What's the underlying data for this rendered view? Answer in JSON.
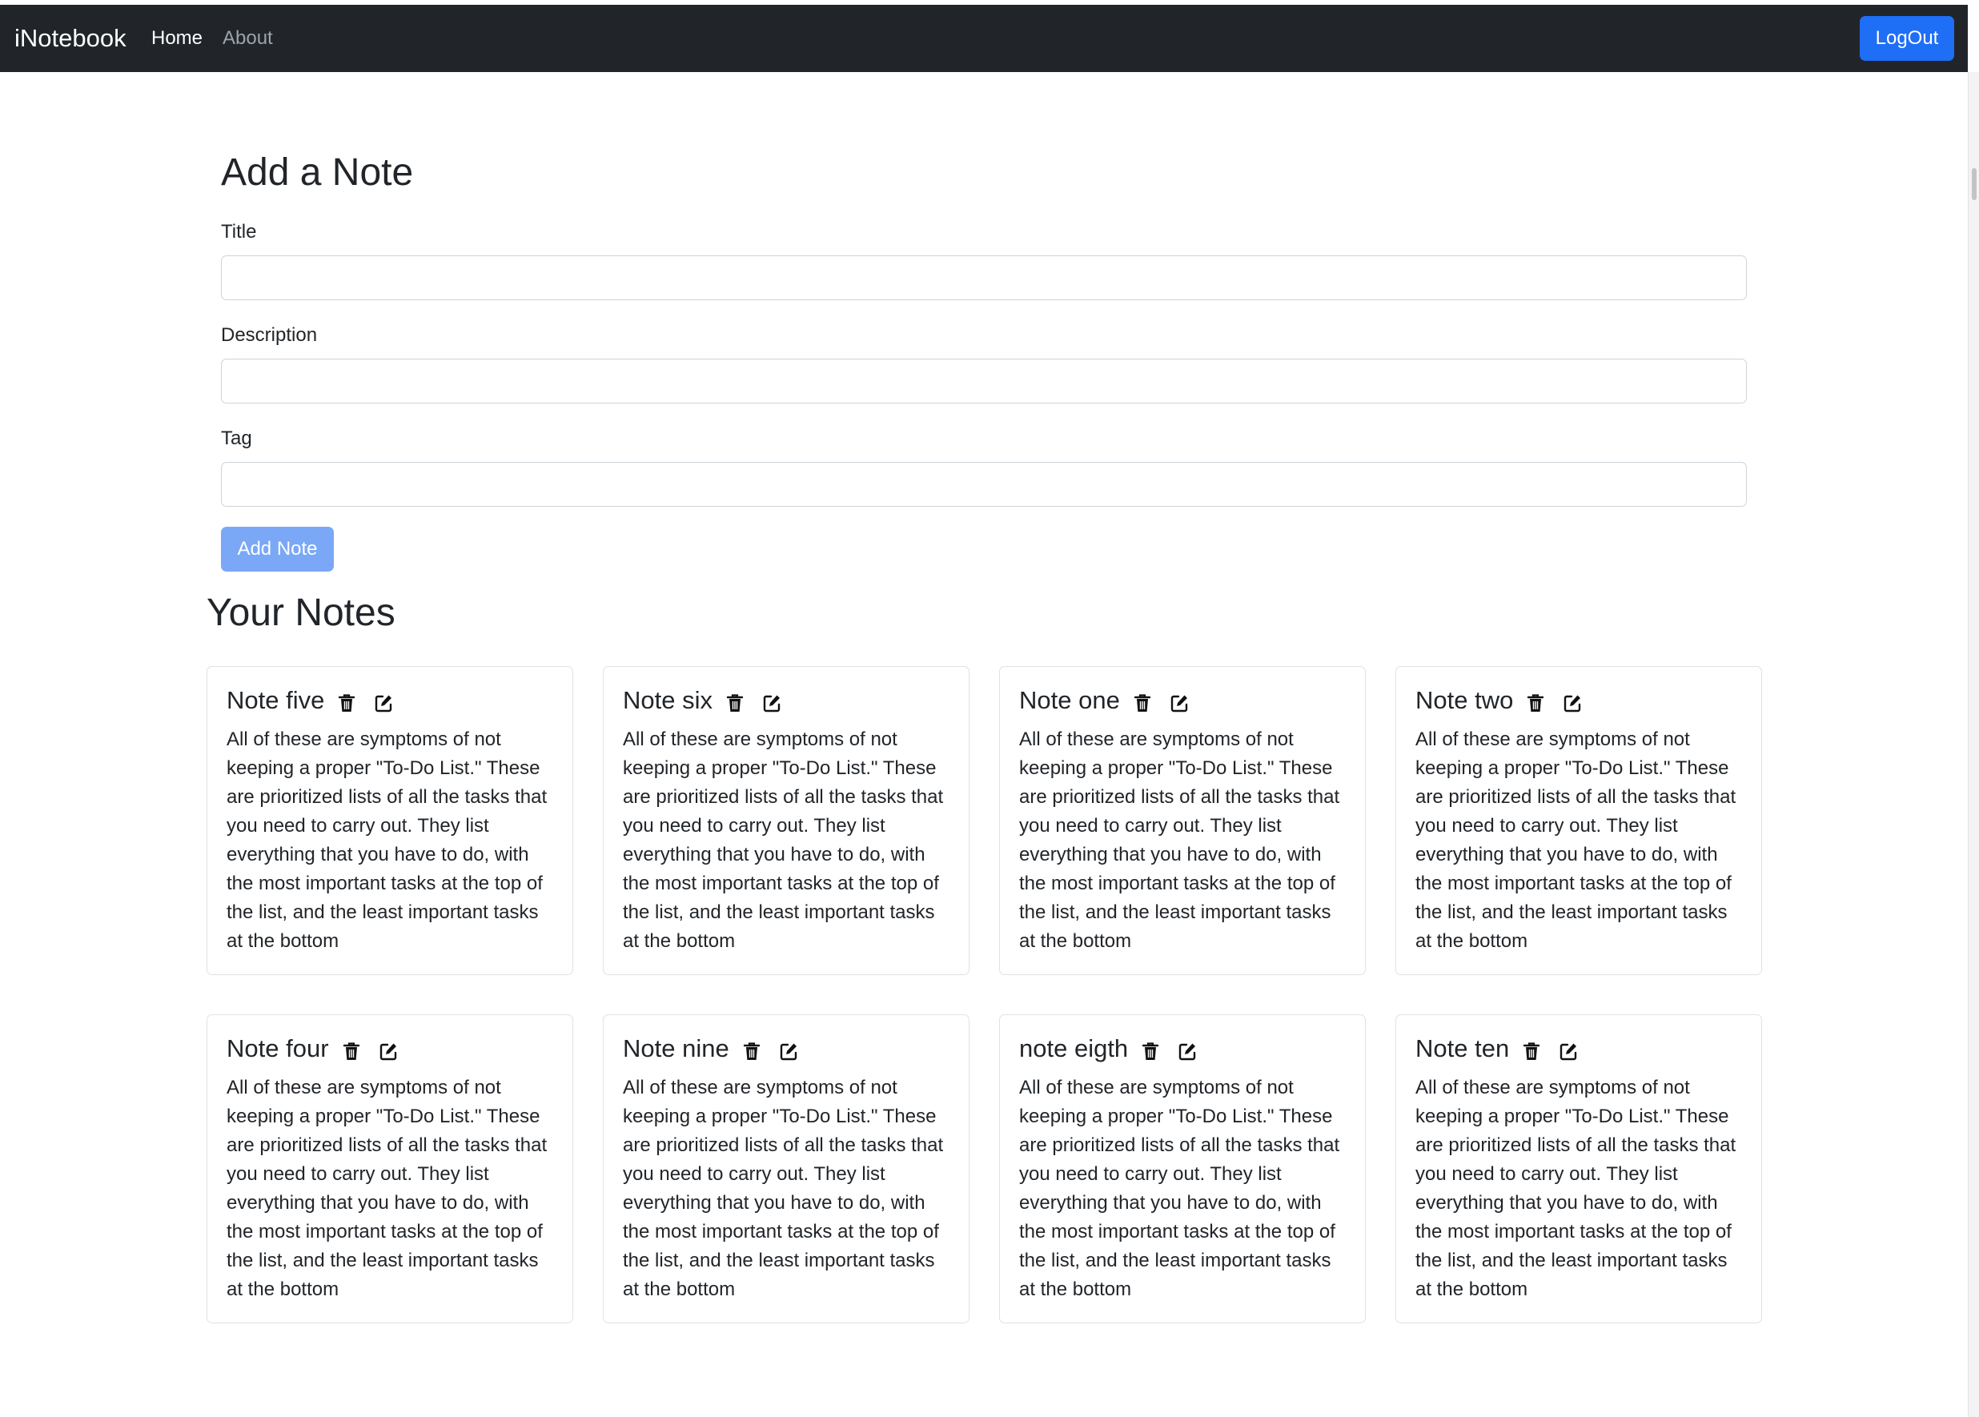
{
  "navbar": {
    "brand": "iNotebook",
    "home_label": "Home",
    "about_label": "About",
    "logout_label": "LogOut",
    "bg_color": "#212529",
    "accent_color": "#1f6ef6"
  },
  "add_note": {
    "heading": "Add a Note",
    "title_label": "Title",
    "title_value": "",
    "description_label": "Description",
    "description_value": "",
    "tag_label": "Tag",
    "tag_value": "",
    "submit_label": "Add Note",
    "submit_state": "disabled"
  },
  "notes_section": {
    "heading": "Your Notes",
    "notes": [
      {
        "title": "Note five",
        "description": "All of these are symptoms of not keeping a proper \"To-Do List.\" These are prioritized lists of all the tasks that you need to carry out. They list everything that you have to do, with the most important tasks at the top of the list, and the least important tasks at the bottom"
      },
      {
        "title": "Note six",
        "description": "All of these are symptoms of not keeping a proper \"To-Do List.\" These are prioritized lists of all the tasks that you need to carry out. They list everything that you have to do, with the most important tasks at the top of the list, and the least important tasks at the bottom"
      },
      {
        "title": "Note one",
        "description": "All of these are symptoms of not keeping a proper \"To-Do List.\" These are prioritized lists of all the tasks that you need to carry out. They list everything that you have to do, with the most important tasks at the top of the list, and the least important tasks at the bottom"
      },
      {
        "title": "Note two",
        "description": "All of these are symptoms of not keeping a proper \"To-Do List.\" These are prioritized lists of all the tasks that you need to carry out. They list everything that you have to do, with the most important tasks at the top of the list, and the least important tasks at the bottom"
      },
      {
        "title": "Note four",
        "description": "All of these are symptoms of not keeping a proper \"To-Do List.\" These are prioritized lists of all the tasks that you need to carry out. They list everything that you have to do, with the most important tasks at the top of the list, and the least important tasks at the bottom"
      },
      {
        "title": "Note nine",
        "description": "All of these are symptoms of not keeping a proper \"To-Do List.\" These are prioritized lists of all the tasks that you need to carry out. They list everything that you have to do, with the most important tasks at the top of the list, and the least important tasks at the bottom"
      },
      {
        "title": "note eigth",
        "description": "All of these are symptoms of not keeping a proper \"To-Do List.\" These are prioritized lists of all the tasks that you need to carry out. They list everything that you have to do, with the most important tasks at the top of the list, and the least important tasks at the bottom"
      },
      {
        "title": "Note ten",
        "description": "All of these are symptoms of not keeping a proper \"To-Do List.\" These are prioritized lists of all the tasks that you need to carry out. They list everything that you have to do, with the most important tasks at the top of the list, and the least important tasks at the bottom"
      }
    ],
    "note_icons": [
      "trash-icon",
      "edit-icon"
    ]
  }
}
